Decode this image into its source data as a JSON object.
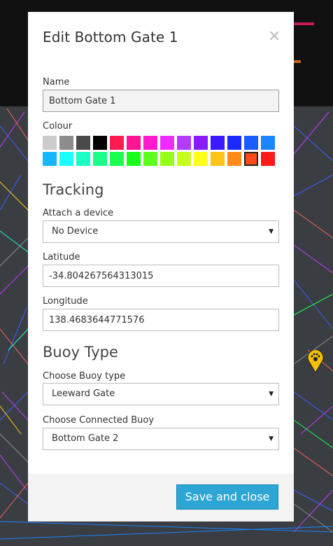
{
  "dialog": {
    "title": "Edit Bottom Gate 1",
    "close_glyph": "×",
    "name_label": "Name",
    "name_value": "Bottom Gate 1",
    "colour_label": "Colour",
    "colours": [
      "#cccccc",
      "#8c8c8c",
      "#4a4a4a",
      "#000000",
      "#ff1a50",
      "#ff1493",
      "#ff1acd",
      "#ee2cff",
      "#b23cff",
      "#8a1aff",
      "#3c1aff",
      "#1a2bff",
      "#1a5cff",
      "#1a85ff",
      "#1ab5ff",
      "#1affff",
      "#1affc4",
      "#1aff8a",
      "#1aff50",
      "#1aff1a",
      "#5cff1a",
      "#95ff1a",
      "#c8ff1a",
      "#ffff1a",
      "#ffc31a",
      "#ff8c1a",
      "#ff4a1a",
      "#ff1a1a"
    ],
    "selected_colour": "#ff4a1a",
    "tracking_heading": "Tracking",
    "device_label": "Attach a device",
    "device_value": "No Device",
    "latitude_label": "Latitude",
    "latitude_value": "-34.804267564313015",
    "longitude_label": "Longitude",
    "longitude_value": "138.4683644771576",
    "buoy_heading": "Buoy Type",
    "buoy_type_label": "Choose Buoy type",
    "buoy_type_value": "Leeward Gate",
    "connected_label": "Choose Connected Buoy",
    "connected_value": "Bottom Gate 2",
    "caret_glyph": "▼",
    "save_label": "Save and close"
  },
  "icons": {
    "close": "close-icon",
    "dropdown": "chevron-down-icon",
    "map_marker": "paw-marker-icon"
  }
}
